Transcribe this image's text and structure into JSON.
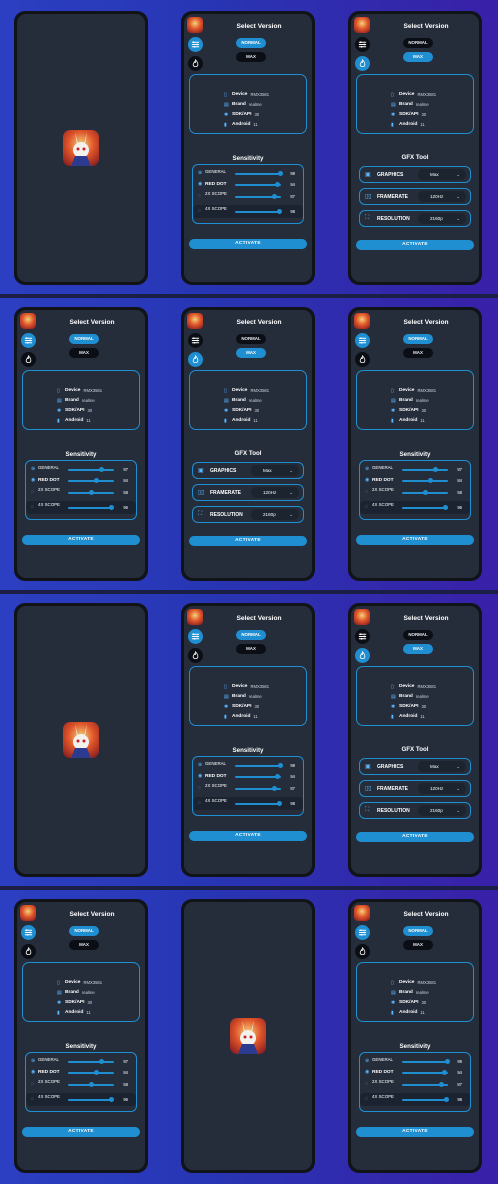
{
  "colors": {
    "accent": "#1f8fd2",
    "screen": "#252d3b",
    "background": "#2c3fc2"
  },
  "select_version": {
    "title": "Select Version",
    "options": [
      "NORMAL",
      "MAX"
    ]
  },
  "device_info": [
    {
      "icon": "phone-icon",
      "key": "Device",
      "value": "RMX3581"
    },
    {
      "icon": "brand-icon",
      "key": "Brand",
      "value": "realme"
    },
    {
      "icon": "android-icon",
      "key": "SDK/API",
      "value": "30"
    },
    {
      "icon": "battery-icon",
      "key": "Android",
      "value": "11"
    }
  ],
  "sensitivity": {
    "title": "Sensitivity",
    "rows_a": [
      {
        "label": "GENERAL",
        "value": "99",
        "fraction": 0.98
      },
      {
        "label": "RED DOT",
        "value": "94",
        "fraction": 0.93
      },
      {
        "label": "2X SCOPE",
        "value": "87",
        "fraction": 0.86
      },
      {
        "label": "4X SCOPE",
        "value": "98",
        "fraction": 0.97
      }
    ],
    "rows_b": [
      {
        "label": "GENERAL",
        "value": "97",
        "fraction": 0.72
      },
      {
        "label": "RED DOT",
        "value": "84",
        "fraction": 0.62
      },
      {
        "label": "2X SCOPE",
        "value": "58",
        "fraction": 0.5
      },
      {
        "label": "4X SCOPE",
        "value": "96",
        "fraction": 0.95
      }
    ]
  },
  "gfx": {
    "title": "GFX Tool",
    "rows": [
      {
        "icon": "graphics-icon",
        "label": "GRAPHICS",
        "value": "Max"
      },
      {
        "icon": "framerate-icon",
        "label": "FRAMERATE",
        "value": "120Hz"
      },
      {
        "icon": "resolution-icon",
        "label": "RESOLUTION",
        "value": "2160p"
      }
    ]
  },
  "activate_label": "ACTIVATE"
}
